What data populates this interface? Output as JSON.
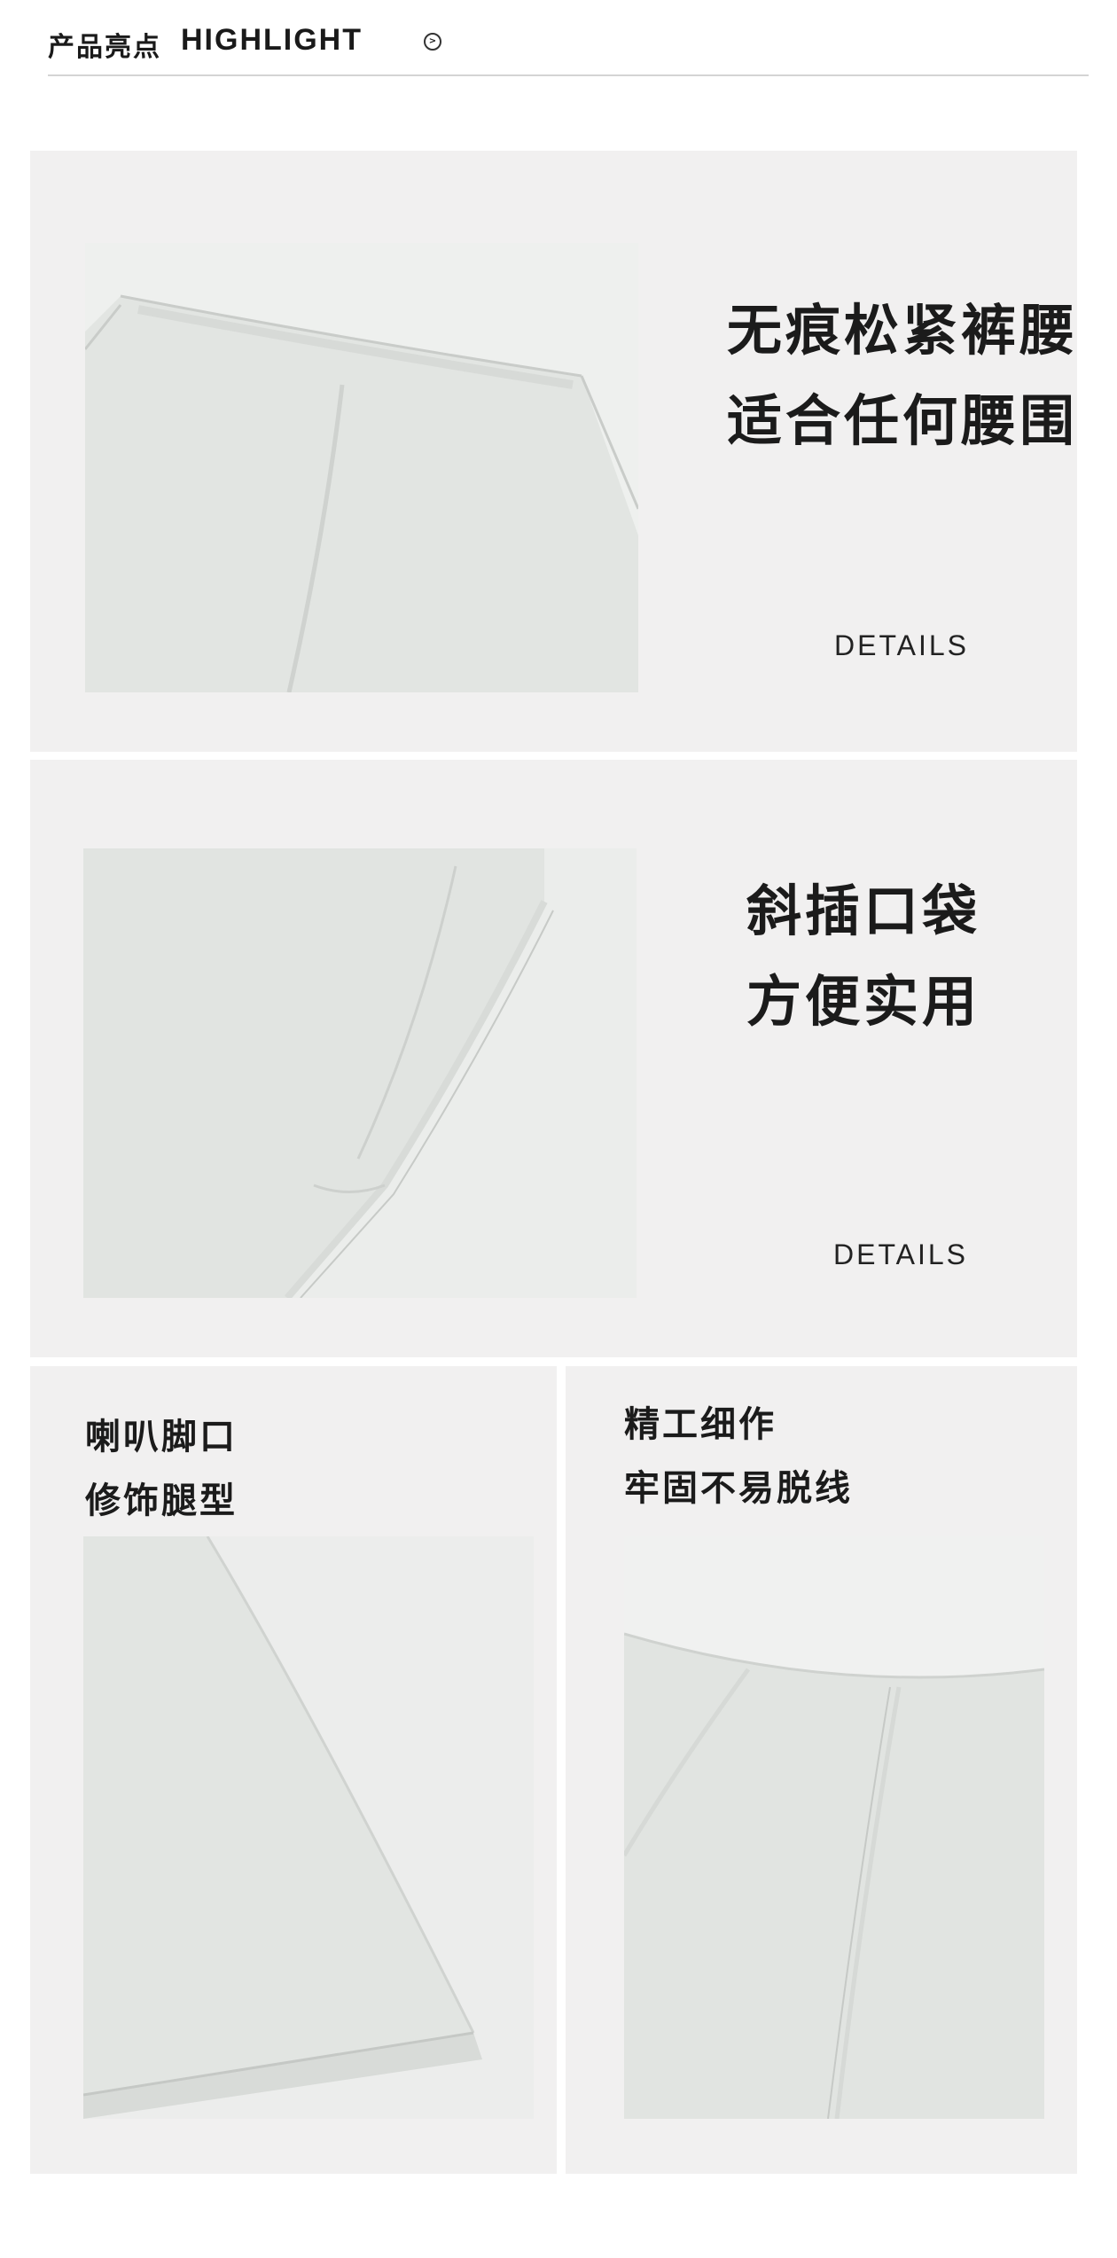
{
  "header": {
    "title_cn": "产品亮点",
    "title_en": "HIGHLIGHT",
    "arrow_icon": "circle-arrow-right-icon"
  },
  "sections": [
    {
      "line1": "无痕松紧裤腰",
      "line2": "适合任何腰围",
      "details_label": "DETAILS",
      "image_subject": "waistband-closeup"
    },
    {
      "line1": "斜插口袋",
      "line2": "方便实用",
      "details_label": "DETAILS",
      "image_subject": "pocket-closeup"
    },
    {
      "line1": "喇叭脚口",
      "line2": "修饰腿型",
      "image_subject": "flared-hem-closeup"
    },
    {
      "line1": "精工细作",
      "line2": "牢固不易脱线",
      "image_subject": "seam-closeup"
    }
  ],
  "colors": {
    "panel_bg": "#f1f0f0",
    "fabric": "#e4e7e4",
    "text": "#1b1b1b"
  }
}
